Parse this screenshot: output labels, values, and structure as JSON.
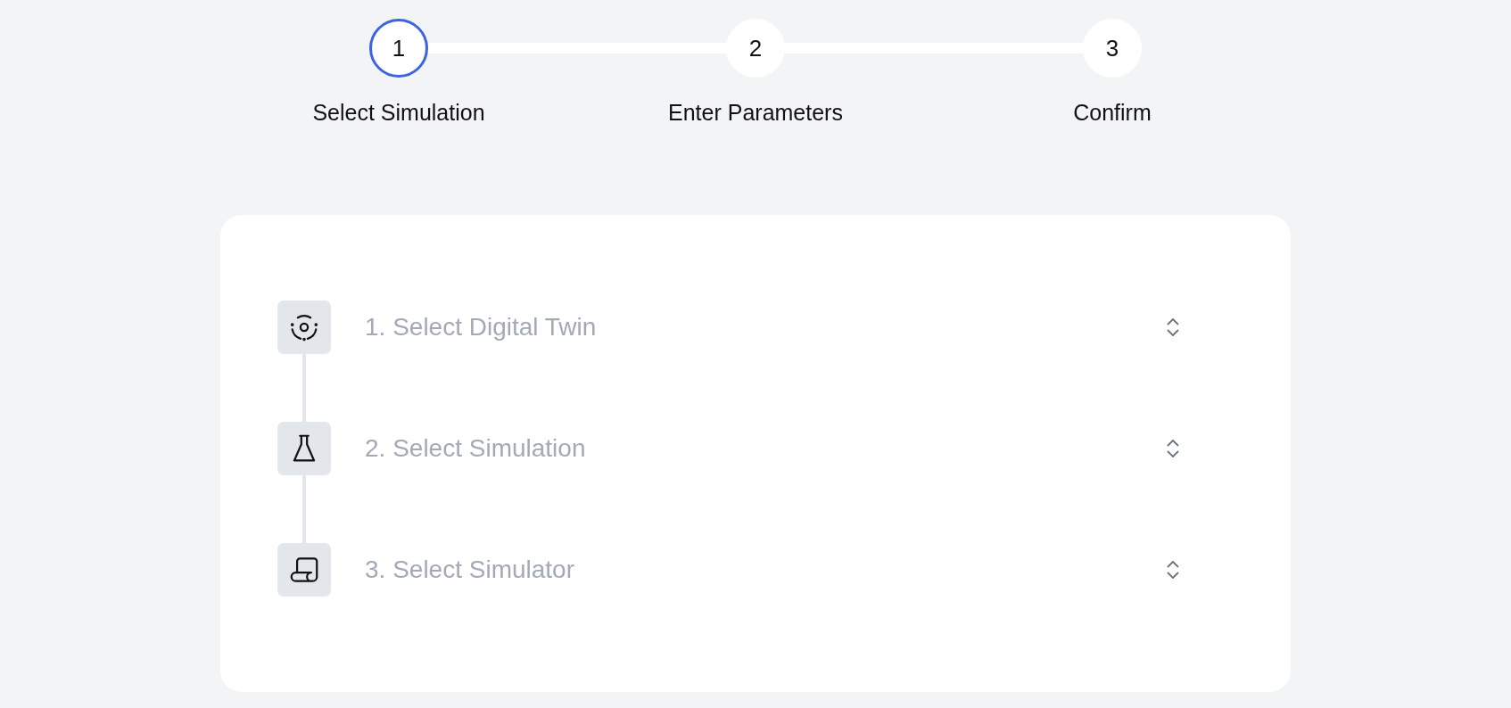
{
  "stepper": {
    "steps": [
      {
        "number": "1",
        "label": "Select Simulation",
        "selected": true
      },
      {
        "number": "2",
        "label": "Enter Parameters",
        "selected": false
      },
      {
        "number": "3",
        "label": "Confirm",
        "selected": false
      }
    ]
  },
  "sections": [
    {
      "kind": "twin",
      "label": "1. Select Digital Twin"
    },
    {
      "kind": "simulation",
      "label": "2. Select Simulation"
    },
    {
      "kind": "simulator",
      "label": "3. Select Simulator"
    }
  ]
}
